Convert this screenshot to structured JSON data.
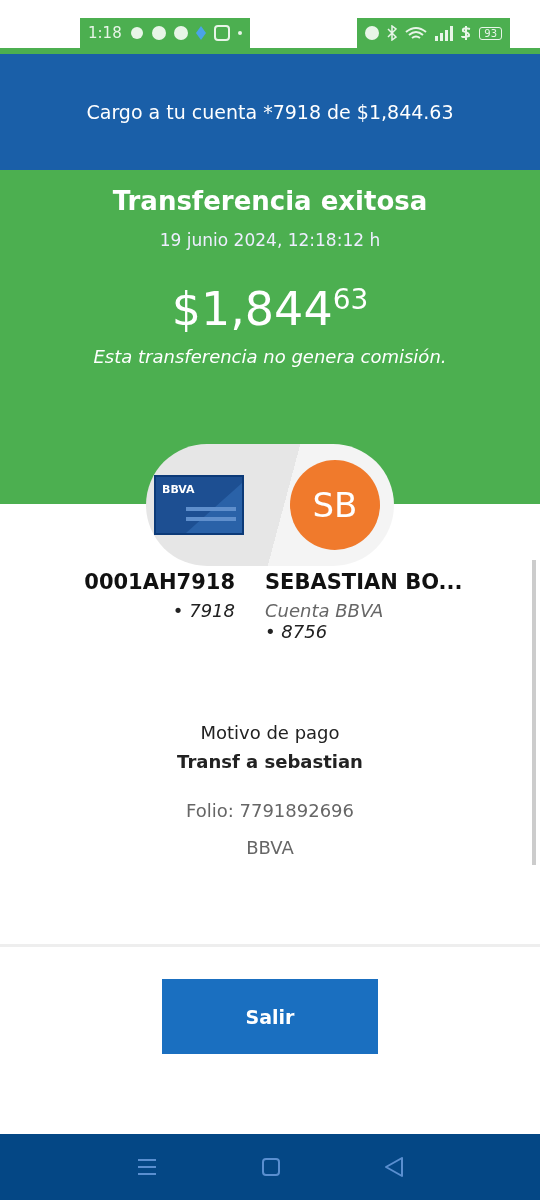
{
  "status_bar": {
    "time": "1:18",
    "battery": "93"
  },
  "header": {
    "title": "Cargo a tu cuenta *7918 de $1,844.63"
  },
  "result": {
    "title": "Transferencia exitosa",
    "date": "19 junio 2024, 12:18:12 h",
    "amount": "$1,844$^{63}$",
    "note": "Esta transferencia no genera comisión."
  },
  "origin": {
    "card_label": "BBVA",
    "name": "0001AH7918",
    "account": "• 7918"
  },
  "destination": {
    "initials": "SB",
    "name": "SEBASTIAN BO...",
    "bank": "Cuenta BBVA",
    "account": "• 8756"
  },
  "details": {
    "reason_label": "Motivo de pago",
    "reason": "Transf a sebastian",
    "folio": "Folio: 7791892696",
    "bank": "BBVA"
  },
  "buttons": [
    {
      "label": "Salir"
    }
  ]
}
